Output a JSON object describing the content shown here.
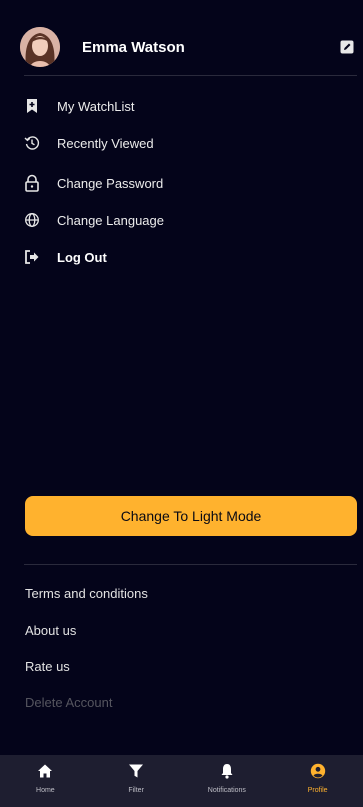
{
  "profile": {
    "name": "Emma Watson"
  },
  "menu": {
    "items": [
      {
        "label": "My WatchList",
        "icon": "bookmark-plus-icon"
      },
      {
        "label": "Recently Viewed",
        "icon": "history-icon"
      },
      {
        "label": "Change Password",
        "icon": "lock-icon"
      },
      {
        "label": "Change Language",
        "icon": "globe-icon"
      },
      {
        "label": "Log Out",
        "icon": "logout-icon"
      }
    ]
  },
  "theme_button": {
    "label": "Change To Light Mode"
  },
  "links": {
    "terms": "Terms and conditions",
    "about": "About us",
    "rate": "Rate us",
    "delete": "Delete Account"
  },
  "bottom_nav": {
    "items": [
      {
        "label": "Home",
        "icon": "home-icon"
      },
      {
        "label": "Filter",
        "icon": "filter-icon"
      },
      {
        "label": "Notifications",
        "icon": "bell-icon"
      },
      {
        "label": "Profile",
        "icon": "profile-icon",
        "active": true
      }
    ]
  },
  "colors": {
    "accent": "#ffb22e",
    "background": "#04041a",
    "nav_background": "#1e1e30"
  }
}
